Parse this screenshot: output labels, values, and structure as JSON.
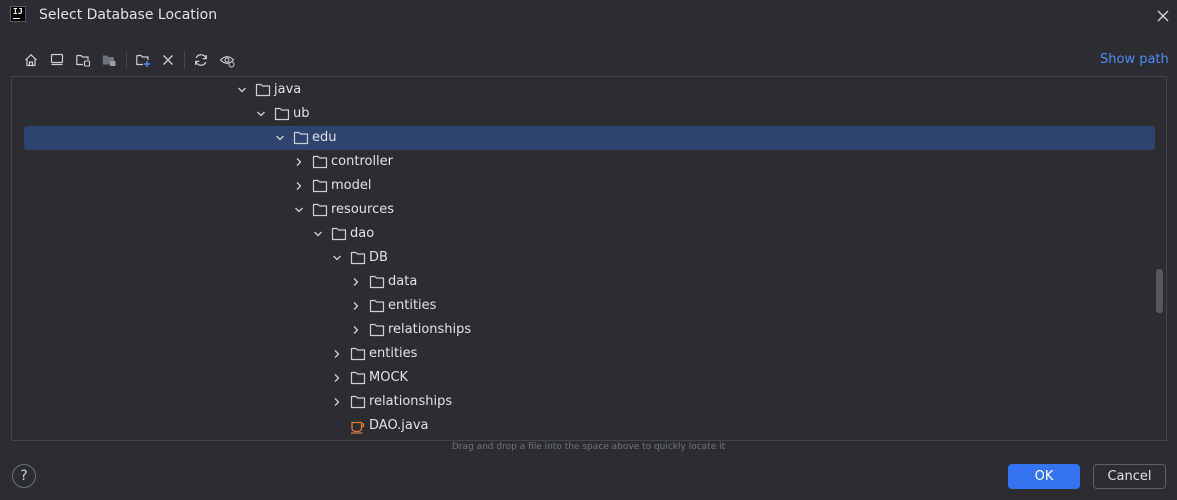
{
  "window": {
    "title": "Select Database Location",
    "app_icon": "IJ",
    "app_icon_name": "intellij-logo"
  },
  "toolbar": {
    "buttons": [
      {
        "icon": "home-icon"
      },
      {
        "icon": "desktop-icon"
      },
      {
        "icon": "project-folder-icon"
      },
      {
        "icon": "module-folder-icon"
      },
      {
        "icon": "new-folder-icon"
      },
      {
        "icon": "delete-icon"
      },
      {
        "icon": "refresh-icon"
      },
      {
        "icon": "show-hidden-icon"
      }
    ],
    "show_path_label": "Show path"
  },
  "tree": {
    "rows": [
      {
        "label": "java",
        "depth": 0,
        "expanded": true,
        "has_children": true,
        "type": "folder"
      },
      {
        "label": "ub",
        "depth": 1,
        "expanded": true,
        "has_children": true,
        "type": "folder"
      },
      {
        "label": "edu",
        "depth": 2,
        "expanded": true,
        "has_children": true,
        "type": "folder",
        "selected": true
      },
      {
        "label": "controller",
        "depth": 3,
        "expanded": false,
        "has_children": true,
        "type": "folder"
      },
      {
        "label": "model",
        "depth": 3,
        "expanded": false,
        "has_children": true,
        "type": "folder"
      },
      {
        "label": "resources",
        "depth": 3,
        "expanded": true,
        "has_children": true,
        "type": "folder"
      },
      {
        "label": "dao",
        "depth": 4,
        "expanded": true,
        "has_children": true,
        "type": "folder"
      },
      {
        "label": "DB",
        "depth": 5,
        "expanded": true,
        "has_children": true,
        "type": "folder"
      },
      {
        "label": "data",
        "depth": 6,
        "expanded": false,
        "has_children": true,
        "type": "folder"
      },
      {
        "label": "entities",
        "depth": 6,
        "expanded": false,
        "has_children": true,
        "type": "folder"
      },
      {
        "label": "relationships",
        "depth": 6,
        "expanded": false,
        "has_children": true,
        "type": "folder"
      },
      {
        "label": "entities",
        "depth": 5,
        "expanded": false,
        "has_children": true,
        "type": "folder"
      },
      {
        "label": "MOCK",
        "depth": 5,
        "expanded": false,
        "has_children": true,
        "type": "folder"
      },
      {
        "label": "relationships",
        "depth": 5,
        "expanded": false,
        "has_children": true,
        "type": "folder"
      },
      {
        "label": "DAO.java",
        "depth": 5,
        "expanded": false,
        "has_children": false,
        "type": "java-file"
      }
    ]
  },
  "hint": "Drag and drop a file into the space above to quickly locate it",
  "footer": {
    "help_label": "?",
    "ok_label": "OK",
    "cancel_label": "Cancel"
  },
  "colors": {
    "background": "#2b2d30",
    "selection": "#2e436e",
    "accent": "#3574f0",
    "link": "#548af7",
    "java_file": "#e0763b"
  }
}
